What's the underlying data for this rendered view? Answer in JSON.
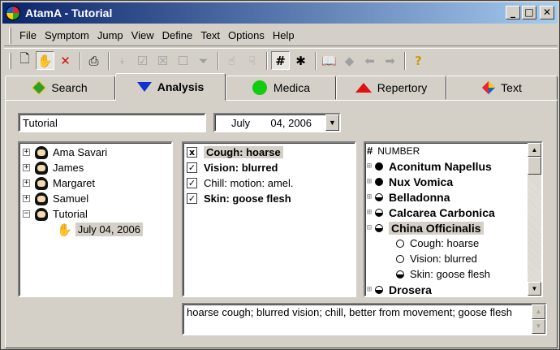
{
  "window": {
    "title": "AtamA - Tutorial",
    "controls": {
      "minimize": "_",
      "maximize": "□",
      "close": "✕"
    }
  },
  "menu": [
    "File",
    "Symptom",
    "Jump",
    "View",
    "Define",
    "Text",
    "Options",
    "Help"
  ],
  "toolbar_icons": [
    "new-document-icon",
    "hand-icon",
    "delete-icon",
    "print-icon",
    "filter-icon",
    "check-icon",
    "cross-box-icon",
    "empty-box-icon",
    "funnel-icon",
    "hand-pointer-icon",
    "hand-down-icon",
    "number-sign-icon",
    "asterisk-icon",
    "book-icon",
    "stack-icon",
    "back-arrow-icon",
    "forward-arrow-icon",
    "help-icon"
  ],
  "tabs": [
    {
      "label": "Search",
      "icon": "green-diamond",
      "color": "#2aa02a"
    },
    {
      "label": "Analysis",
      "icon": "blue-triangle",
      "color": "#1030d0",
      "active": true
    },
    {
      "label": "Medica",
      "icon": "green-circle",
      "color": "#11cc11"
    },
    {
      "label": "Repertory",
      "icon": "red-triangle",
      "color": "#e01010"
    },
    {
      "label": "Text",
      "icon": "multicolor-diamond",
      "color": "#16c"
    }
  ],
  "analysis": {
    "name_value": "Tutorial",
    "date": {
      "month": "July",
      "day_year": "04, 2006"
    },
    "patients": [
      {
        "name": "Ama Savari",
        "expander": "+"
      },
      {
        "name": "James",
        "expander": "+"
      },
      {
        "name": "Margaret",
        "expander": "+"
      },
      {
        "name": "Samuel",
        "expander": "+"
      },
      {
        "name": "Tutorial",
        "expander": "−"
      }
    ],
    "selected_session": "July 04, 2006",
    "symptoms": [
      {
        "label": "Cough: hoarse",
        "state": "x",
        "bold": true,
        "highlight": true
      },
      {
        "label": "Vision: blurred",
        "state": "✓",
        "bold": true
      },
      {
        "label": "Chill: motion: amel.",
        "state": "✓",
        "bold": false
      },
      {
        "label": "Skin: goose flesh",
        "state": "✓",
        "bold": true
      }
    ],
    "remedy_header": "NUMBER",
    "remedies": [
      {
        "name": "Aconitum Napellus",
        "level": "full"
      },
      {
        "name": "Nux Vomica",
        "level": "full"
      },
      {
        "name": "Belladonna",
        "level": "half"
      },
      {
        "name": "Calcarea Carbonica",
        "level": "half"
      },
      {
        "name": "China Officinalis",
        "level": "half",
        "highlight": true
      }
    ],
    "remedy_children": [
      {
        "name": "Cough: hoarse",
        "level": "empty"
      },
      {
        "name": "Vision: blurred",
        "level": "empty"
      },
      {
        "name": "Skin: goose flesh",
        "level": "half"
      }
    ],
    "remedy_last": {
      "name": "Drosera",
      "level": "half"
    },
    "notes": "hoarse cough; blurred vision; chill, better from movement; goose flesh"
  }
}
